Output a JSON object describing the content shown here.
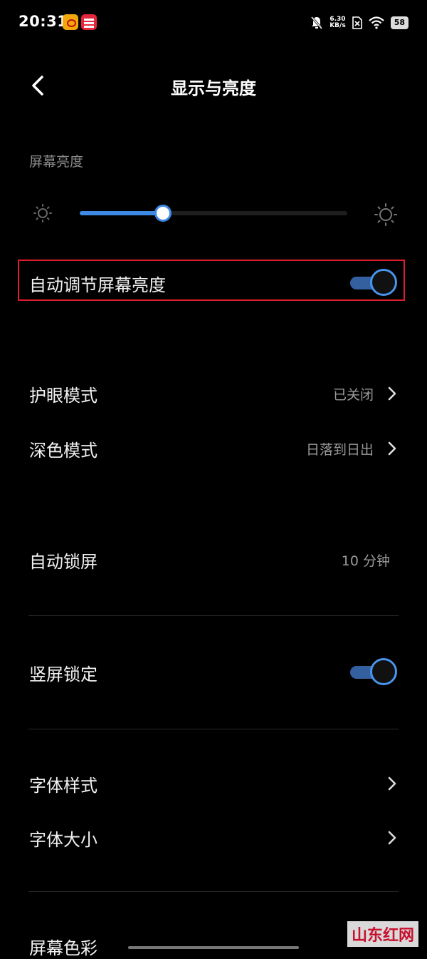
{
  "status_bar": {
    "time": "20:31",
    "net_speed_value": "6.30",
    "net_speed_unit": "KB/s",
    "battery": "58"
  },
  "header": {
    "title": "显示与亮度"
  },
  "brightness": {
    "section_label": "屏幕亮度",
    "level_percent": 31
  },
  "settings": {
    "auto_brightness": {
      "label": "自动调节屏幕亮度",
      "enabled": true
    },
    "eye_care": {
      "label": "护眼模式",
      "value": "已关闭"
    },
    "dark_mode": {
      "label": "深色模式",
      "value": "日落到日出"
    },
    "auto_lock": {
      "label": "自动锁屏",
      "value": "10 分钟"
    },
    "portrait_lock": {
      "label": "竖屏锁定",
      "enabled": true
    },
    "font_style": {
      "label": "字体样式"
    },
    "font_size": {
      "label": "字体大小"
    },
    "screen_color": {
      "label": "屏幕色彩"
    }
  },
  "watermark": "山东红网",
  "colors": {
    "accent": "#3d8ae6",
    "highlight_border": "#e01e2b",
    "background": "#000000"
  }
}
